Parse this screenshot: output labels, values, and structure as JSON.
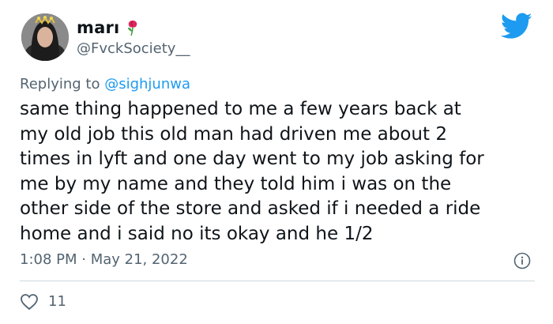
{
  "author": {
    "display_name": "marı",
    "handle": "@FvckSociety__"
  },
  "reply": {
    "prefix": "Replying to ",
    "mention": "@sighjunwa"
  },
  "tweet": {
    "text": "same thing happened to me a few years back at\nmy old job this old man had driven me about 2\ntimes in lyft and one day went to my job asking for\nme by my name and they told him i was on the\nother side of the store and asked if i needed a ride\nhome and i said no its okay and he 1/2",
    "timestamp": "1:08 PM · May 21, 2022"
  },
  "engagement": {
    "likes": "11"
  },
  "colors": {
    "brand": "#1d9bf0",
    "secondary_text": "#536471",
    "primary_text": "#0f1419",
    "divider": "#cfd9de"
  },
  "icons": [
    "rose-icon",
    "twitter-bird-icon",
    "info-icon",
    "heart-icon"
  ]
}
